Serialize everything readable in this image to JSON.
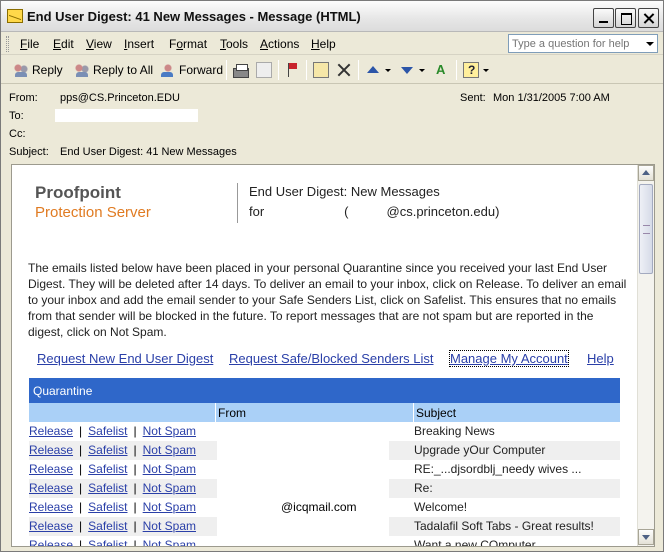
{
  "window": {
    "title": "End User Digest: 41 New Messages  - Message (HTML)"
  },
  "menu": {
    "items": [
      {
        "pre": "",
        "ul": "F",
        "post": "ile"
      },
      {
        "pre": "",
        "ul": "E",
        "post": "dit"
      },
      {
        "pre": "",
        "ul": "V",
        "post": "iew"
      },
      {
        "pre": "",
        "ul": "I",
        "post": "nsert"
      },
      {
        "pre": "F",
        "ul": "o",
        "post": "rmat"
      },
      {
        "pre": "",
        "ul": "T",
        "post": "ools"
      },
      {
        "pre": "",
        "ul": "A",
        "post": "ctions"
      },
      {
        "pre": "",
        "ul": "H",
        "post": "elp"
      }
    ],
    "help_placeholder": "Type a question for help"
  },
  "toolbar": {
    "reply": "Reply",
    "reply_all": "Reply to All",
    "forward": "Forward"
  },
  "header": {
    "from_label": "From:",
    "from_value": "pps@CS.Princeton.EDU",
    "to_label": "To:",
    "cc_label": "Cc:",
    "subject_label": "Subject:",
    "subject_value": "End User Digest: 41 New Messages",
    "sent_label": "Sent:",
    "sent_value": "Mon 1/31/2005 7:00 AM"
  },
  "body": {
    "brand": "Proofpoint",
    "brand_sub": "Protection Server",
    "digest_title": "End User Digest: New Messages",
    "for_label": "for",
    "for_paren_open": "(",
    "for_domain": "@cs.princeton.edu)",
    "intro": "The emails listed below have been placed in your personal Quarantine since you received your last End User Digest. They will be deleted after 14 days. To deliver an email to your inbox, click on Release. To deliver an email to your inbox and add the email sender to your Safe Senders List, click on Safelist. This ensures that no emails from that sender will be blocked in the future. To report messages that are not spam but are reported in the digest, click on Not Spam.",
    "links": {
      "request_digest": "Request New End User Digest",
      "request_lists": "Request Safe/Blocked Senders List",
      "manage_account": "Manage My Account",
      "help": "Help"
    }
  },
  "quarantine": {
    "title": "Quarantine",
    "col_from": "From",
    "col_subject": "Subject",
    "action_release": "Release",
    "action_safelist": "Safelist",
    "action_notspam": "Not Spam",
    "rows": [
      {
        "from": "",
        "subject": "Breaking News"
      },
      {
        "from": "",
        "subject": "Upgrade yOur Computer"
      },
      {
        "from": "",
        "subject": "RE:_...djsordblj_needy wives ..."
      },
      {
        "from": "",
        "subject": "Re:"
      },
      {
        "from": "@icqmail.com",
        "subject": "Welcome!"
      },
      {
        "from": "",
        "subject": "Tadalafil Soft Tabs - Great results!"
      },
      {
        "from": "",
        "subject": "Want a new COmputer"
      }
    ]
  },
  "colors": {
    "quarantine_header": "#2f67c9",
    "column_header": "#aad0f7",
    "link": "#2a3fa8",
    "brand_orange": "#e07b22"
  }
}
